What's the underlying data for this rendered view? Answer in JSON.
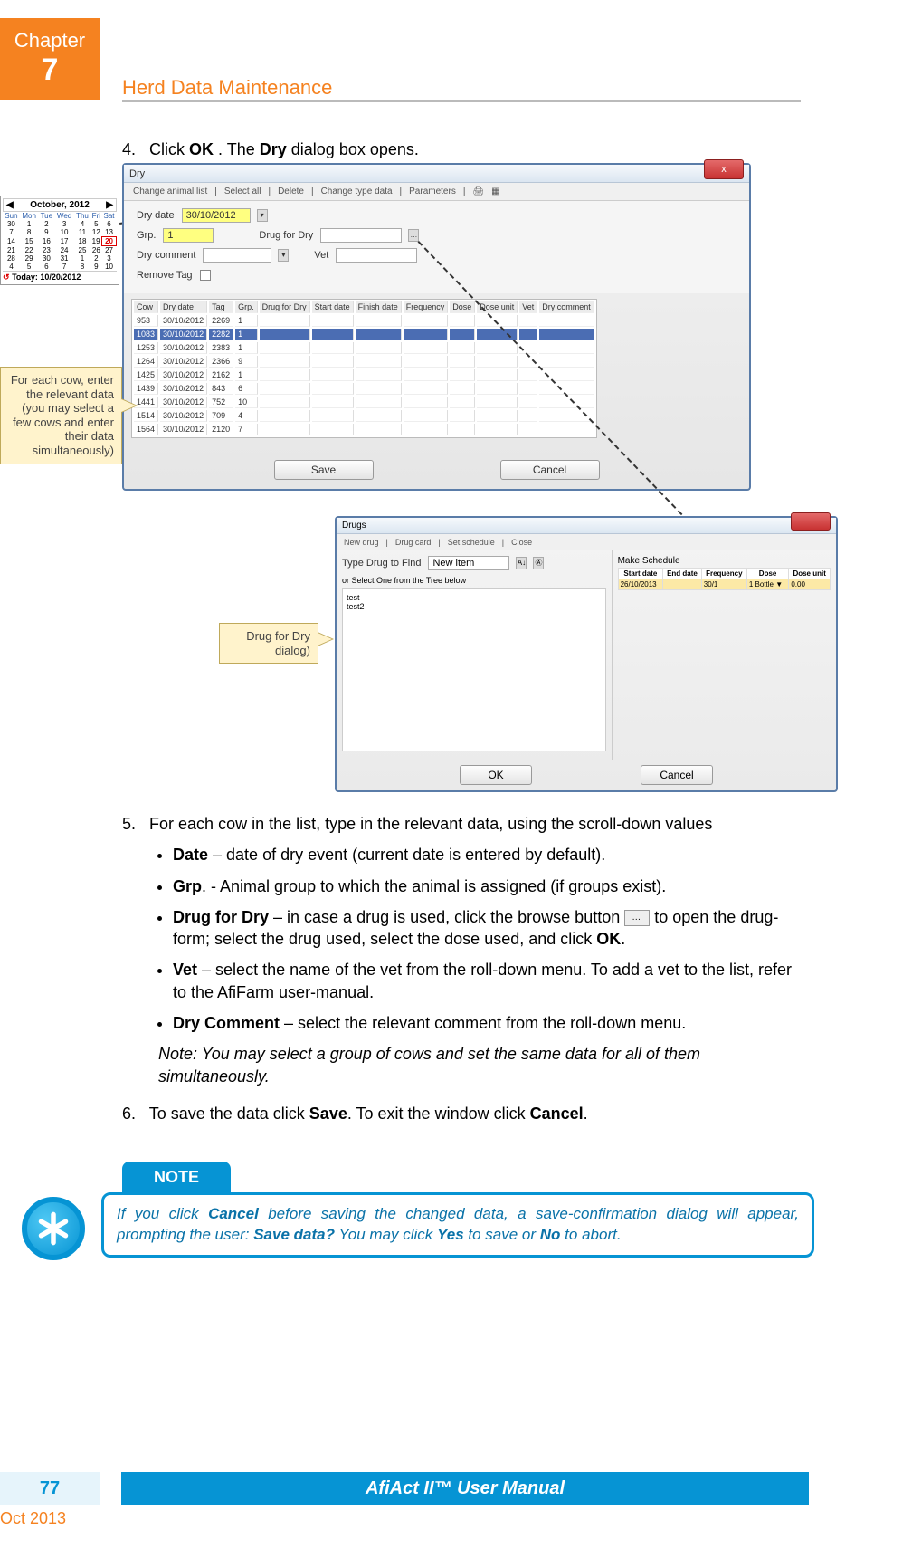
{
  "chapter": {
    "label": "Chapter",
    "number": "7"
  },
  "section_title": "Herd Data Maintenance",
  "step4": {
    "num": "4.",
    "pre": "Click ",
    "ok": "OK",
    "mid": ". The ",
    "dry": "Dry",
    "post": " dialog box opens."
  },
  "dry_dialog": {
    "title": "Dry",
    "close": "x",
    "toolbar": [
      "Change animal list",
      "Select all",
      "Delete",
      "Change type data",
      "Parameters"
    ],
    "dry_date_label": "Dry date",
    "dry_date_value": "30/10/2012",
    "grp_label": "Grp.",
    "grp_value": "1",
    "drug_label": "Drug for Dry",
    "drug_value": "",
    "dry_comment_label": "Dry comment",
    "vet_label": "Vet",
    "remove_tag_label": "Remove Tag",
    "columns": [
      "Cow",
      "Dry date",
      "Tag",
      "Grp.",
      "Drug for Dry",
      "Start date",
      "Finish date",
      "Frequency",
      "Dose",
      "Dose unit",
      "Vet",
      "Dry comment"
    ],
    "rows": [
      {
        "cow": "953",
        "date": "30/10/2012",
        "tag": "2269",
        "grp": "1"
      },
      {
        "cow": "1083",
        "date": "30/10/2012",
        "tag": "2282",
        "grp": "1",
        "sel": true
      },
      {
        "cow": "1253",
        "date": "30/10/2012",
        "tag": "2383",
        "grp": "1"
      },
      {
        "cow": "1264",
        "date": "30/10/2012",
        "tag": "2366",
        "grp": "9"
      },
      {
        "cow": "1425",
        "date": "30/10/2012",
        "tag": "2162",
        "grp": "1"
      },
      {
        "cow": "1439",
        "date": "30/10/2012",
        "tag": "843",
        "grp": "6"
      },
      {
        "cow": "1441",
        "date": "30/10/2012",
        "tag": "752",
        "grp": "10"
      },
      {
        "cow": "1514",
        "date": "30/10/2012",
        "tag": "709",
        "grp": "4"
      },
      {
        "cow": "1564",
        "date": "30/10/2012",
        "tag": "2120",
        "grp": "7"
      }
    ],
    "save": "Save",
    "cancel": "Cancel"
  },
  "calendar": {
    "month": "October, 2012",
    "days": [
      "Sun",
      "Mon",
      "Tue",
      "Wed",
      "Thu",
      "Fri",
      "Sat"
    ],
    "weeks": [
      [
        "30",
        "1",
        "2",
        "3",
        "4",
        "5",
        "6"
      ],
      [
        "7",
        "8",
        "9",
        "10",
        "11",
        "12",
        "13"
      ],
      [
        "14",
        "15",
        "16",
        "17",
        "18",
        "19",
        "20"
      ],
      [
        "21",
        "22",
        "23",
        "24",
        "25",
        "26",
        "27"
      ],
      [
        "28",
        "29",
        "30",
        "31",
        "1",
        "2",
        "3"
      ],
      [
        "4",
        "5",
        "6",
        "7",
        "8",
        "9",
        "10"
      ]
    ],
    "today_cell": "20",
    "today_label": "Today: 10/20/2012"
  },
  "annot_cows": "For each cow, enter the relevant data (you may select a few cows and enter their data simultaneously)",
  "annot_drug": "Drug for Dry dialog)",
  "drugs_dialog": {
    "title": "Drugs",
    "toolbar": [
      "New drug",
      "Drug card",
      "Set schedule",
      "Close"
    ],
    "type_label": "Type Drug to Find",
    "type_value": "New item",
    "or_label": "or Select One from the Tree below",
    "tree": [
      "test",
      "test2"
    ],
    "sched_label": "Make Schedule",
    "sched_cols": [
      "Start date",
      "End date",
      "Frequency",
      "Dose",
      "Dose unit"
    ],
    "sched_row": [
      "26/10/2013",
      "",
      "30/1",
      "1",
      "Bottle",
      "▼",
      "0.00"
    ],
    "ok": "OK",
    "cancel": "Cancel"
  },
  "step5": {
    "num": "5.",
    "text": "For each cow in the list, type in the relevant data, using the scroll-down values",
    "bullets": {
      "date_b": "Date",
      "date_t": " – date of dry event (current date is entered by default).",
      "grp_b": "Grp",
      "grp_t": ". - Animal group to which the animal is assigned (if groups exist).",
      "drug_b": "Drug for Dry",
      "drug_t1": " – in case a drug is used, click the browse button ",
      "drug_t2": " to open the drug-form; select the drug used, select the dose used, and click ",
      "drug_ok": "OK",
      "drug_t3": ".",
      "vet_b": "Vet",
      "vet_t": " – select the name of the vet from the roll-down menu. To add a vet to the list, refer to the AfiFarm user-manual.",
      "dcom_b": "Dry Comment",
      "dcom_t": " – select the relevant comment from the roll-down menu."
    },
    "note": "Note: You may select a group of cows and set the same data for all of them simultaneously."
  },
  "step6": {
    "num": "6.",
    "pre": "To save the data click ",
    "save": "Save",
    "mid": ". To exit the window click ",
    "cancel": "Cancel",
    "post": "."
  },
  "note_block": {
    "tab": "NOTE",
    "t1": "If you click ",
    "cancel": "Cancel",
    "t2": " before saving the changed data, a save-confirmation dialog will appear, prompting the user: ",
    "save_q": "Save data?",
    "t3": " You may click ",
    "yes": "Yes",
    "t4": " to save or ",
    "no": "No",
    "t5": " to abort."
  },
  "footer": {
    "page": "77",
    "manual": "AfiAct II™ User Manual",
    "date": "Oct 2013"
  }
}
